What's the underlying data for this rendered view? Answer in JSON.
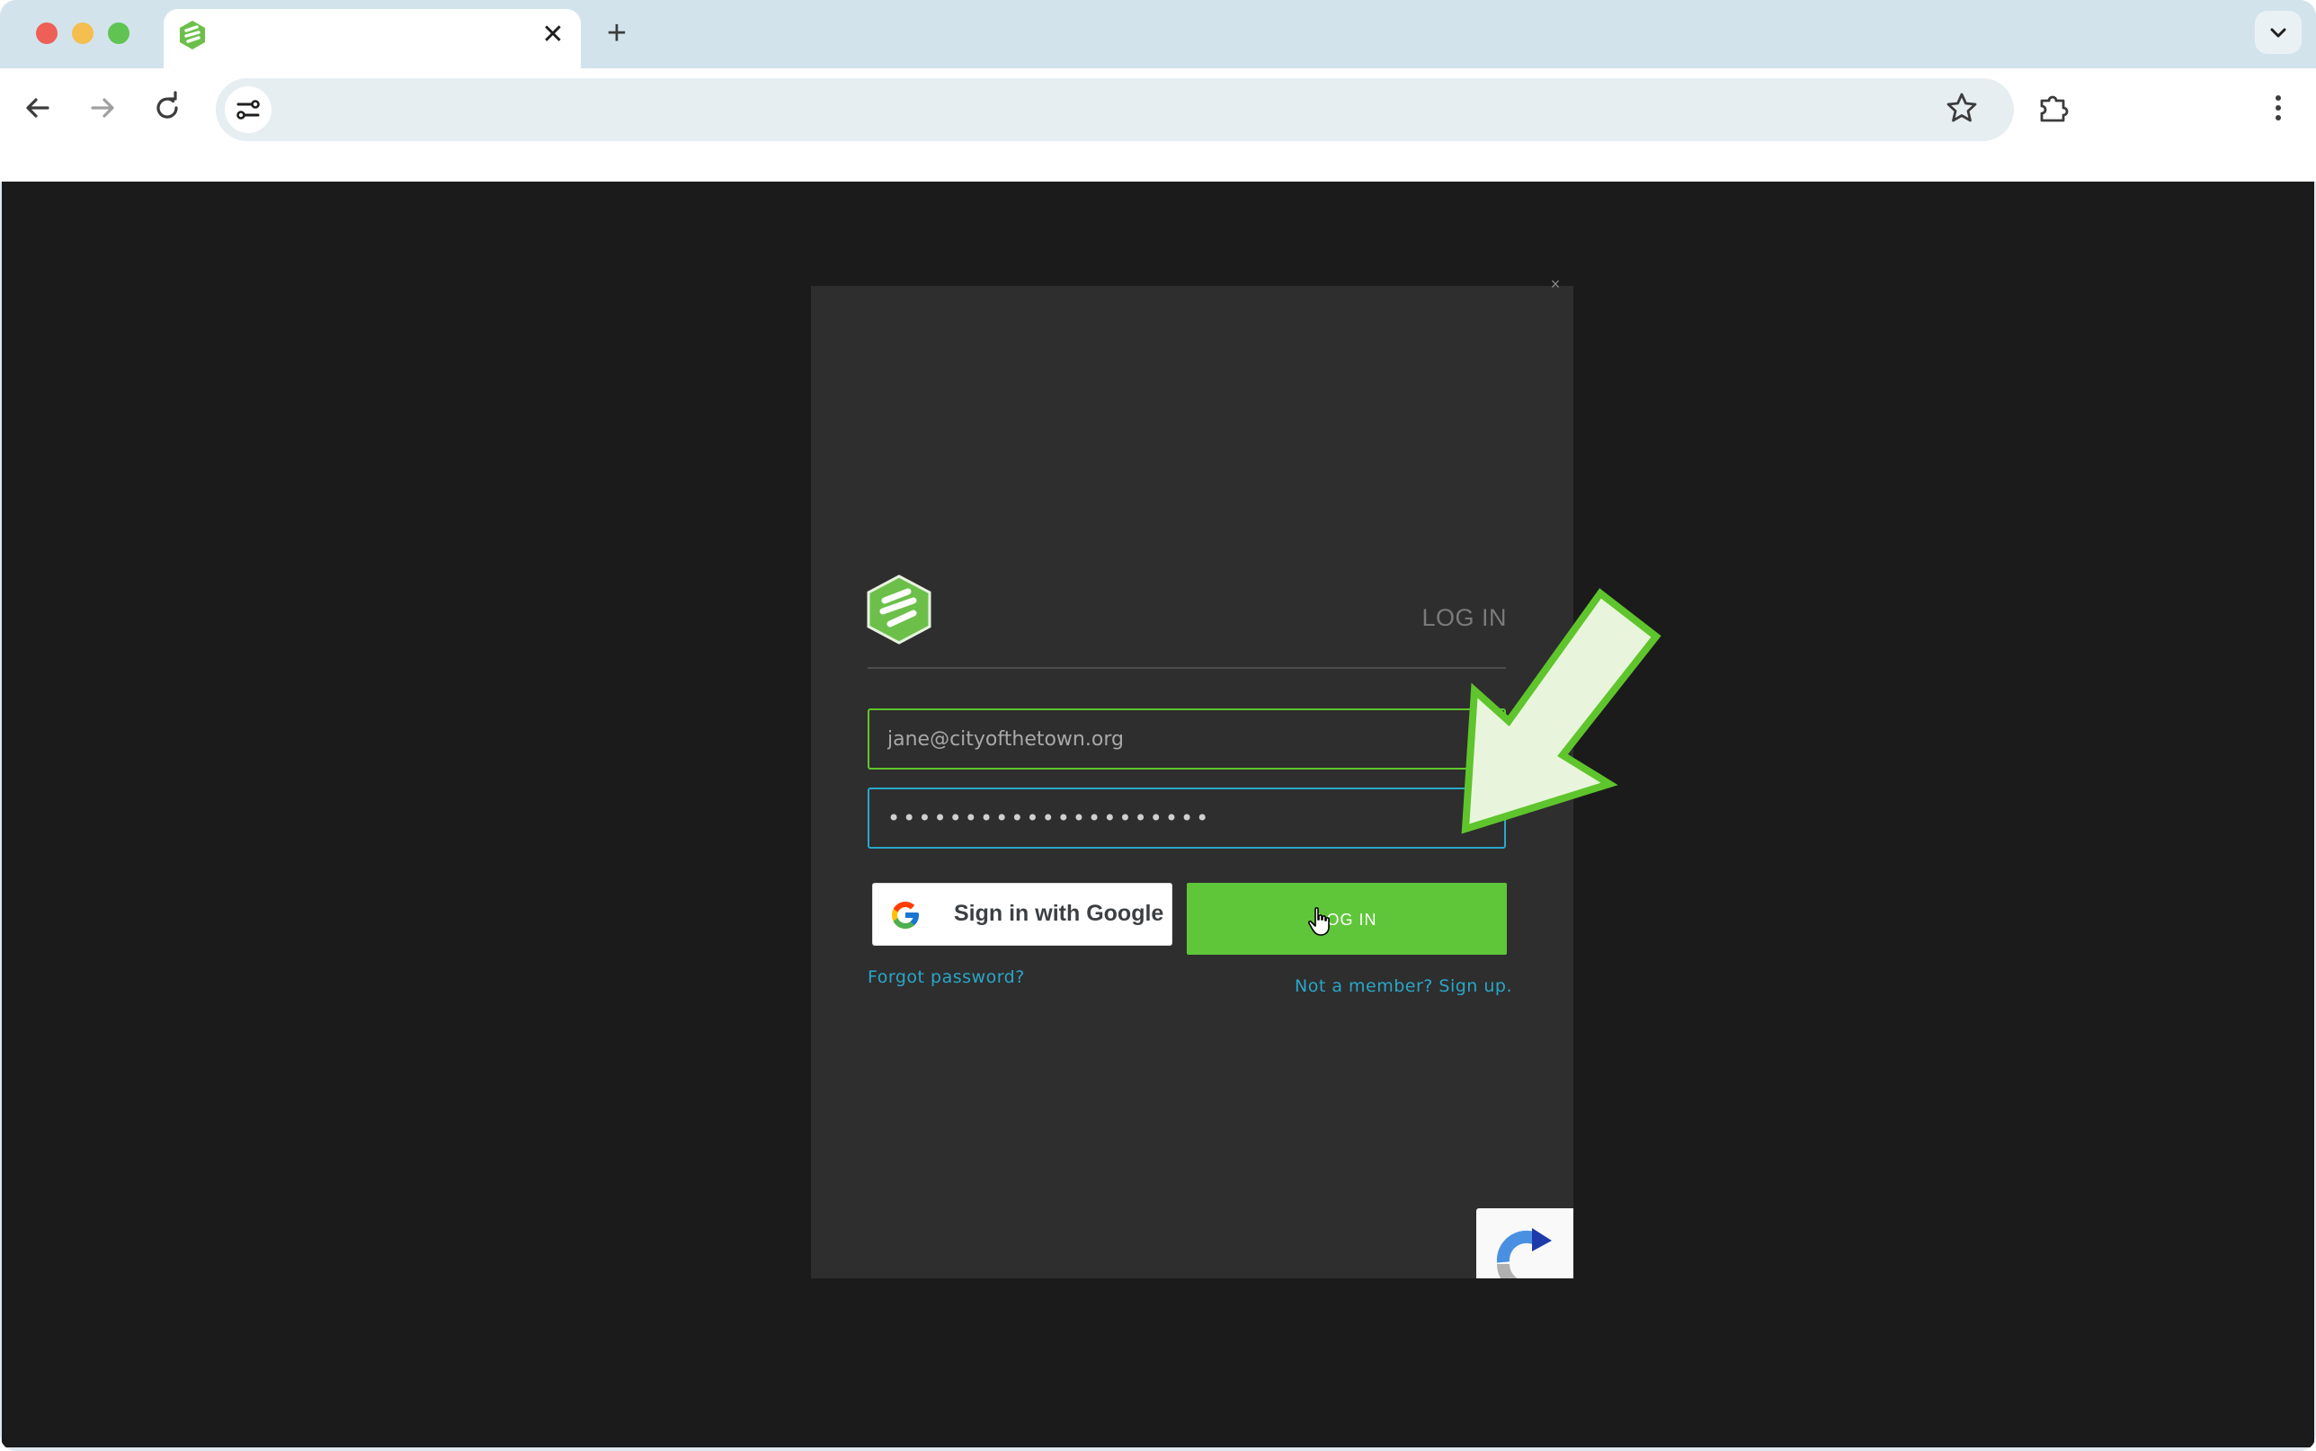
{
  "browser": {
    "tab": {
      "title": "",
      "favicon": "site-logo-icon",
      "close_symbol": "✕"
    },
    "new_tab_symbol": "+",
    "address_bar": {
      "value": "",
      "placeholder": ""
    },
    "icons": {
      "back": "arrow-left-icon",
      "forward": "arrow-right-icon",
      "reload": "reload-icon",
      "site_info": "tune-icon",
      "bookmark": "star-icon",
      "extensions": "puzzle-icon",
      "menu": "kebab-menu-icon"
    }
  },
  "login_modal": {
    "close_symbol": "×",
    "heading": "LOG IN",
    "email_value": "jane@cityofthetown.org",
    "password_value": "•••••••••••••••••••••",
    "google_button_label": "Sign in with Google",
    "login_button_label": "LOG IN",
    "forgot_password_link": "Forgot password?",
    "signup_link": "Not a member? Sign up."
  },
  "colors": {
    "brand_green": "#5fc63a",
    "link_blue": "#2aa6c8",
    "modal_bg": "#2e2e2e",
    "page_bg": "#1b1b1b",
    "arrow_fill": "#e8f5dc",
    "arrow_stroke": "#5fc52c"
  }
}
